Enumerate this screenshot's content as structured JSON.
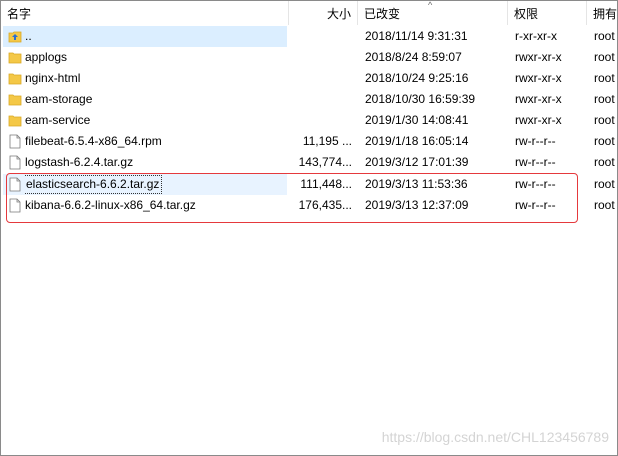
{
  "columns": {
    "name": "名字",
    "size": "大小",
    "modified": "已改变",
    "permissions": "权限",
    "owner": "拥有"
  },
  "files": [
    {
      "name": "..",
      "size": "",
      "modified": "2018/11/14 9:31:31",
      "permissions": "r-xr-xr-x",
      "owner": "root",
      "type": "parent-dir",
      "icon": "parent-folder-icon"
    },
    {
      "name": "applogs",
      "size": "",
      "modified": "2018/8/24 8:59:07",
      "permissions": "rwxr-xr-x",
      "owner": "root",
      "type": "folder",
      "icon": "folder-icon"
    },
    {
      "name": "nginx-html",
      "size": "",
      "modified": "2018/10/24 9:25:16",
      "permissions": "rwxr-xr-x",
      "owner": "root",
      "type": "folder",
      "icon": "folder-icon"
    },
    {
      "name": "eam-storage",
      "size": "",
      "modified": "2018/10/30 16:59:39",
      "permissions": "rwxr-xr-x",
      "owner": "root",
      "type": "folder",
      "icon": "folder-icon"
    },
    {
      "name": "eam-service",
      "size": "",
      "modified": "2019/1/30 14:08:41",
      "permissions": "rwxr-xr-x",
      "owner": "root",
      "type": "folder",
      "icon": "folder-icon"
    },
    {
      "name": "filebeat-6.5.4-x86_64.rpm",
      "size": "11,195 ...",
      "modified": "2019/1/18 16:05:14",
      "permissions": "rw-r--r--",
      "owner": "root",
      "type": "file",
      "icon": "file-icon"
    },
    {
      "name": "logstash-6.2.4.tar.gz",
      "size": "143,774...",
      "modified": "2019/3/12 17:01:39",
      "permissions": "rw-r--r--",
      "owner": "root",
      "type": "file",
      "icon": "file-icon"
    },
    {
      "name": "elasticsearch-6.6.2.tar.gz",
      "size": "111,448...",
      "modified": "2019/3/13 11:53:36",
      "permissions": "rw-r--r--",
      "owner": "root",
      "type": "file",
      "icon": "file-icon"
    },
    {
      "name": "kibana-6.6.2-linux-x86_64.tar.gz",
      "size": "176,435...",
      "modified": "2019/3/13 12:37:09",
      "permissions": "rw-r--r--",
      "owner": "root",
      "type": "file",
      "icon": "file-icon"
    }
  ],
  "selected_file": "elasticsearch-6.6.2.tar.gz",
  "watermark": "https://blog.csdn.net/CHL123456789",
  "colors": {
    "folder": "#f4c847",
    "selection": "#e8f3ff",
    "parent_highlight": "#dbeeff",
    "annotation_box": "#e5393d"
  }
}
